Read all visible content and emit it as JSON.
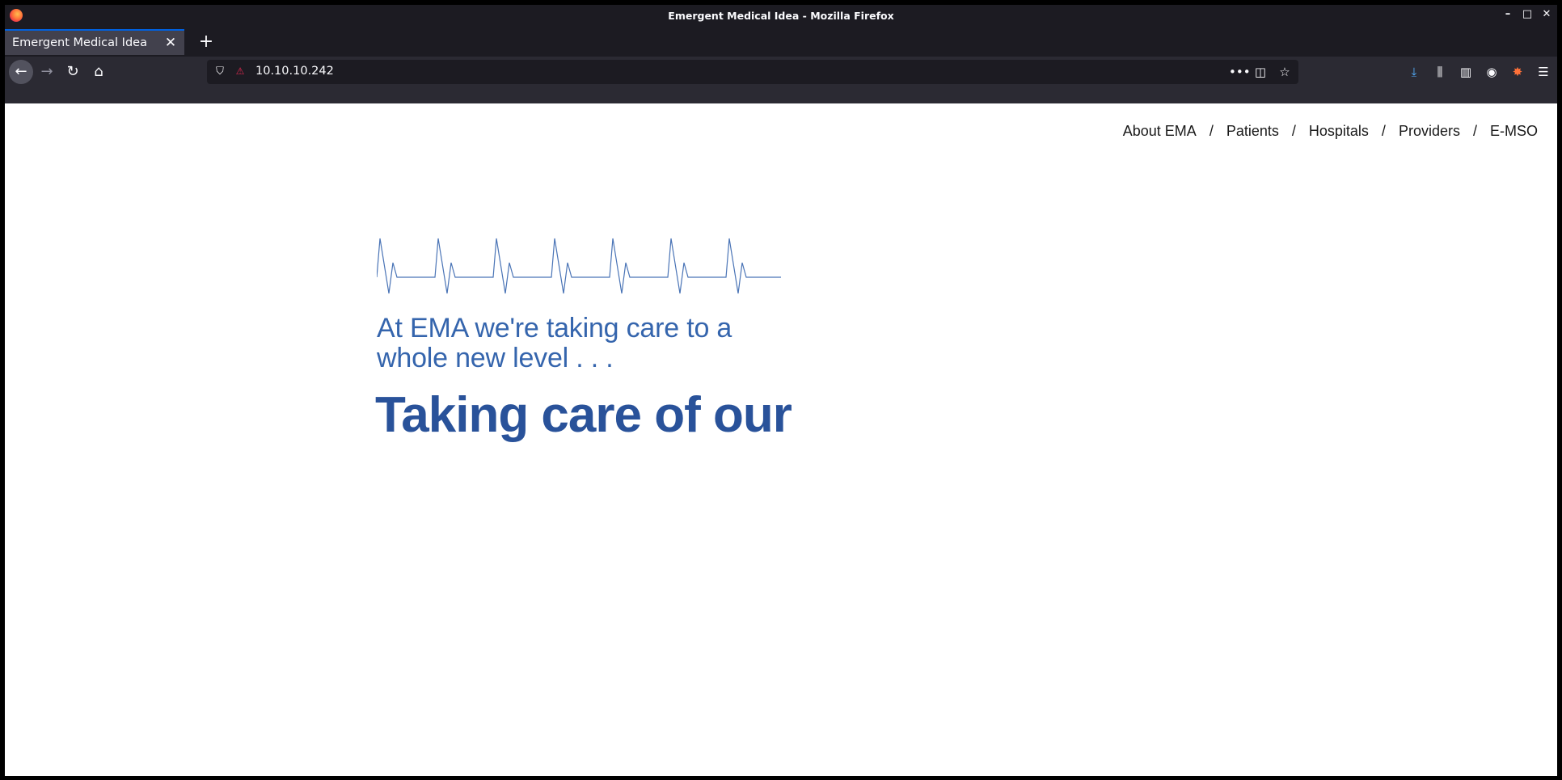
{
  "window": {
    "title": "Emergent Medical Idea - Mozilla Firefox",
    "controls": [
      "–",
      "□",
      "✕"
    ]
  },
  "tabs": [
    {
      "label": "Emergent Medical Idea",
      "active": true
    }
  ],
  "new_tab_label": "+",
  "navigation": {
    "url": "10.10.10.242",
    "back_glyph": "←",
    "forward_glyph": "→",
    "reload_glyph": "↻",
    "home_glyph": "⌂"
  },
  "page": {
    "nav_items": [
      "About EMA",
      "Patients",
      "Hospitals",
      "Providers",
      "E-MSO"
    ],
    "nav_separator": "/",
    "tagline": "At EMA we're taking care to a whole new level . . .",
    "headline": "Taking care of our",
    "colors": {
      "tagline": "#3565ad",
      "headline": "#29529a",
      "heartbeat": "#4a74b6"
    }
  }
}
